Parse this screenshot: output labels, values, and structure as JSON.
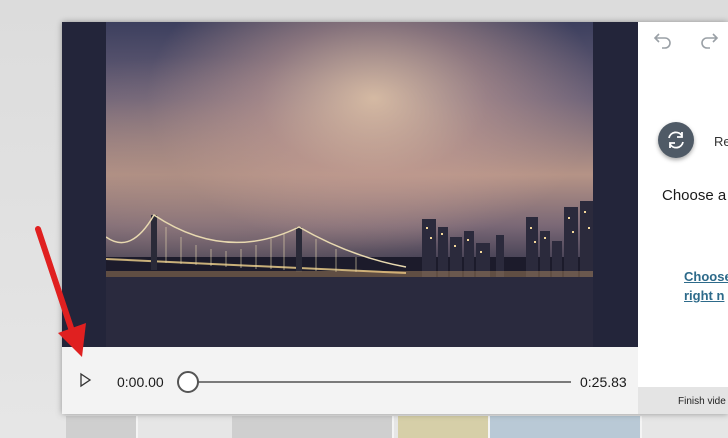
{
  "player": {
    "current_time": "0:00.00",
    "total_time": "0:25.83",
    "progress": 0
  },
  "panel": {
    "refresh_label": "Re",
    "choose_text": "Choose a",
    "choose_link_line1": "Choose",
    "choose_link_line2": "right n",
    "finish_label": "Finish vide"
  },
  "icons": {
    "play": "play-icon",
    "undo": "undo-icon",
    "redo": "redo-icon",
    "refresh": "refresh-icon"
  },
  "colors": {
    "accent_button": "#4f5a66",
    "link": "#2d6a8a",
    "annotation_arrow": "#e02020"
  }
}
